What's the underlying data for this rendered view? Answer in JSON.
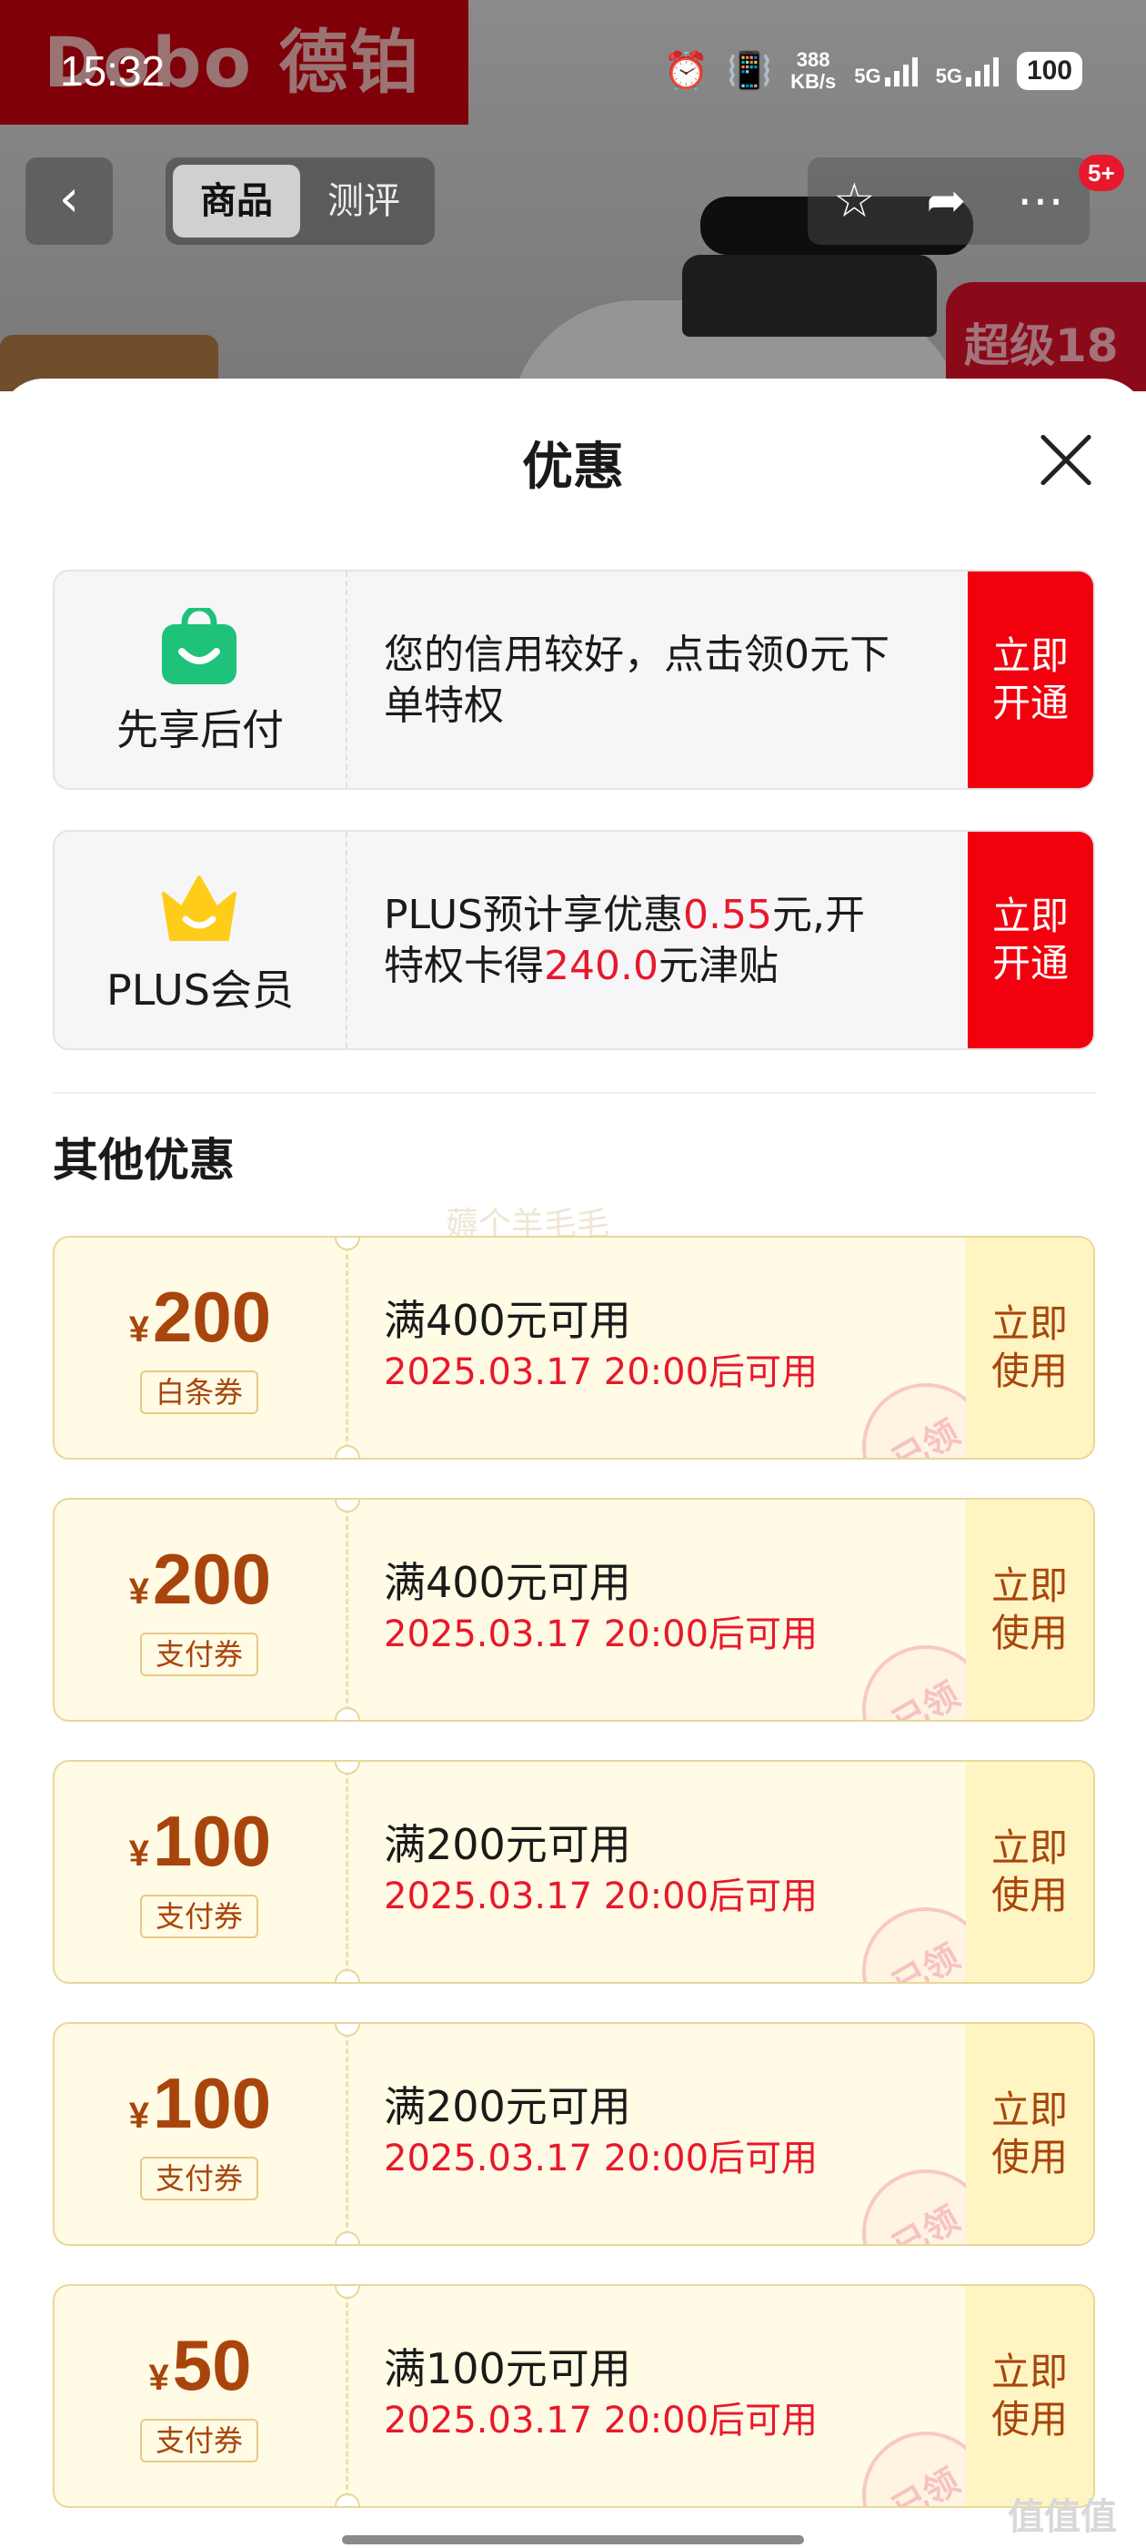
{
  "background": {
    "brand_text": "Dobo 德铂",
    "promo_text": "超级18"
  },
  "status_bar": {
    "time": "15:32",
    "net_speed": "388",
    "net_speed_unit": "KB/s",
    "sim1": "5G",
    "sim2": "5G",
    "battery": "100"
  },
  "nav": {
    "back_icon": "‹",
    "tabs": [
      {
        "label": "商品",
        "active": true
      },
      {
        "label": "测评",
        "active": false
      }
    ],
    "badge": "5+"
  },
  "sheet": {
    "title": "优惠",
    "services": [
      {
        "name": "先享后付",
        "icon": "shopping-bag-icon",
        "icon_color": "#1ec27a",
        "desc_parts": [
          {
            "text": "您的信用较好，点击领0元下单特权",
            "red": false
          }
        ],
        "action": "立即开通"
      },
      {
        "name": "PLUS会员",
        "icon": "crown-icon",
        "icon_color": "#ffcc1a",
        "desc_parts": [
          {
            "text": "PLUS预计享优惠",
            "red": false
          },
          {
            "text": "0.55",
            "red": true
          },
          {
            "text": "元,开特权卡得",
            "red": false
          },
          {
            "text": "240.0",
            "red": true
          },
          {
            "text": "元津贴",
            "red": false
          }
        ],
        "action": "立即开通"
      }
    ],
    "other_title": "其他优惠",
    "watermark": "薅个羊毛毛",
    "coupons": [
      {
        "currency": "¥",
        "amount": "200",
        "type": "白条券",
        "condition": "满400元可用",
        "time": "2025.03.17 20:00后可用",
        "action": "立即使用",
        "stamp": "已领"
      },
      {
        "currency": "¥",
        "amount": "200",
        "type": "支付券",
        "condition": "满400元可用",
        "time": "2025.03.17 20:00后可用",
        "action": "立即使用",
        "stamp": "已领"
      },
      {
        "currency": "¥",
        "amount": "100",
        "type": "支付券",
        "condition": "满200元可用",
        "time": "2025.03.17 20:00后可用",
        "action": "立即使用",
        "stamp": "已领"
      },
      {
        "currency": "¥",
        "amount": "100",
        "type": "支付券",
        "condition": "满200元可用",
        "time": "2025.03.17 20:00后可用",
        "action": "立即使用",
        "stamp": "已领"
      },
      {
        "currency": "¥",
        "amount": "50",
        "type": "支付券",
        "condition": "满100元可用",
        "time": "2025.03.17 20:00后可用",
        "action": "立即使用",
        "stamp": "已领"
      }
    ],
    "corner_mark": "值值值"
  },
  "colors": {
    "accent_red": "#f2000e",
    "coupon_brown": "#a9450c",
    "coupon_bg": "#fffbe4"
  }
}
